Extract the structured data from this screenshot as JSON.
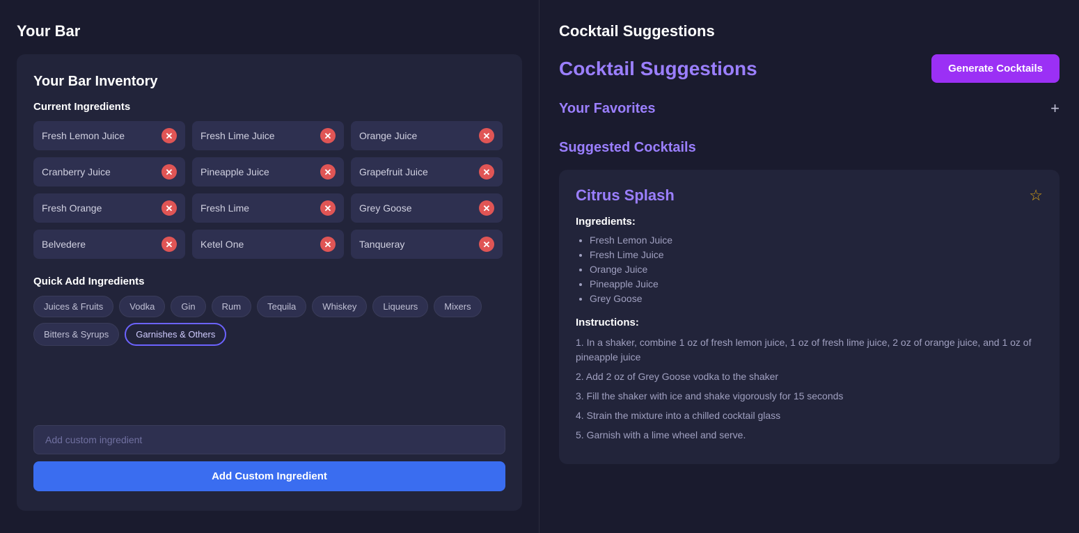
{
  "left": {
    "panel_title": "Your Bar",
    "inventory": {
      "title": "Your Bar Inventory",
      "current_ingredients_label": "Current Ingredients",
      "ingredients": [
        {
          "name": "Fresh Lemon Juice"
        },
        {
          "name": "Fresh Lime Juice"
        },
        {
          "name": "Orange Juice"
        },
        {
          "name": "Cranberry Juice"
        },
        {
          "name": "Pineapple Juice"
        },
        {
          "name": "Grapefruit Juice"
        },
        {
          "name": "Fresh Orange"
        },
        {
          "name": "Fresh Lime"
        },
        {
          "name": "Grey Goose"
        },
        {
          "name": "Belvedere"
        },
        {
          "name": "Ketel One"
        },
        {
          "name": "Tanqueray"
        }
      ],
      "quick_add_label": "Quick Add Ingredients",
      "quick_tags": [
        {
          "label": "Juices & Fruits",
          "active": false
        },
        {
          "label": "Vodka",
          "active": false
        },
        {
          "label": "Gin",
          "active": false
        },
        {
          "label": "Rum",
          "active": false
        },
        {
          "label": "Tequila",
          "active": false
        },
        {
          "label": "Whiskey",
          "active": false
        },
        {
          "label": "Liqueurs",
          "active": false
        },
        {
          "label": "Mixers",
          "active": false
        },
        {
          "label": "Bitters & Syrups",
          "active": false
        },
        {
          "label": "Garnishes & Others",
          "active": true
        }
      ],
      "custom_input_placeholder": "Add custom ingredient",
      "custom_input_label": "Add custom ingredient",
      "add_button_label": "Add Custom Ingredient"
    }
  },
  "right": {
    "panel_title": "Cocktail Suggestions",
    "header_title": "Cocktail Suggestions",
    "generate_button": "Generate Cocktails",
    "favorites_title": "Your Favorites",
    "suggested_title": "Suggested Cocktails",
    "cocktails": [
      {
        "name": "Citrus Splash",
        "ingredients": [
          "Fresh Lemon Juice",
          "Fresh Lime Juice",
          "Orange Juice",
          "Pineapple Juice",
          "Grey Goose"
        ],
        "instructions_label": "Instructions:",
        "ingredients_label": "Ingredients:",
        "instructions": [
          "1. In a shaker, combine 1 oz of fresh lemon juice, 1 oz of fresh lime juice, 2 oz of orange juice, and 1 oz of pineapple juice",
          "2. Add 2 oz of Grey Goose vodka to the shaker",
          "3. Fill the shaker with ice and shake vigorously for 15 seconds",
          "4. Strain the mixture into a chilled cocktail glass",
          "5. Garnish with a lime wheel and serve."
        ]
      }
    ]
  }
}
